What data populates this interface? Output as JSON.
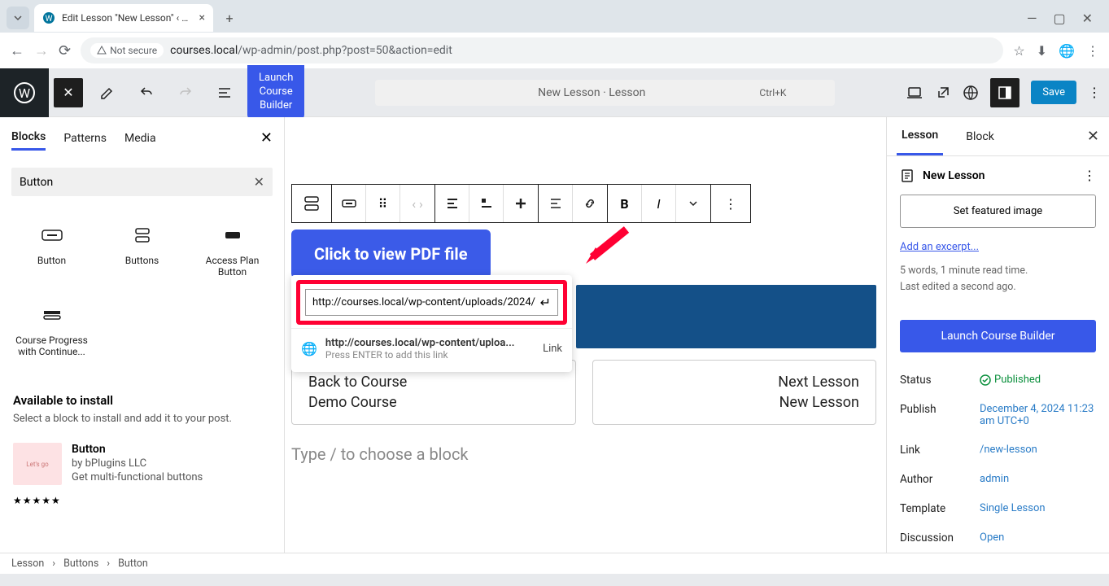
{
  "browser": {
    "tab_title": "Edit Lesson \"New Lesson\" ‹ cou",
    "not_secure": "Not secure",
    "url_host": "courses.local",
    "url_path": "/wp-admin/post.php?post=50&action=edit"
  },
  "toolbar": {
    "launch_btn": "Launch\nCourse\nBuilder",
    "doc_title": "New Lesson · Lesson",
    "shortcut": "Ctrl+K",
    "save": "Save"
  },
  "left": {
    "tabs": [
      "Blocks",
      "Patterns",
      "Media"
    ],
    "search_value": "Button",
    "blocks": [
      {
        "label": "Button"
      },
      {
        "label": "Buttons"
      },
      {
        "label": "Access Plan Button"
      },
      {
        "label": "Course Progress with Continue..."
      }
    ],
    "available_title": "Available to install",
    "available_sub": "Select a block to install and add it to your post.",
    "plugin": {
      "name": "Button",
      "by": "by bPlugins LLC",
      "desc": "Get multi-functional buttons",
      "thumb_text": "Let's go"
    }
  },
  "canvas": {
    "pdf_label": "Click to view PDF file",
    "link_input": "http://courses.local/wp-content/uploads/2024/",
    "link_result_url": "http://courses.local/wp-content/uploa...",
    "link_result_hint": "Press ENTER to add this link",
    "link_action": "Link",
    "back_title": "Back to Course",
    "back_sub": "Demo Course",
    "next_title": "Next Lesson",
    "next_sub": "New Lesson",
    "placeholder": "Type / to choose a block"
  },
  "right": {
    "tabs": [
      "Lesson",
      "Block"
    ],
    "heading": "New Lesson",
    "featured": "Set featured image",
    "excerpt": "Add an excerpt...",
    "meta1": "5 words, 1 minute read time.",
    "meta2": "Last edited a second ago.",
    "launch": "Launch Course Builder",
    "rows": [
      {
        "label": "Status",
        "value": "Published",
        "green": true
      },
      {
        "label": "Publish",
        "value": "December 4, 2024 11:23 am UTC+0"
      },
      {
        "label": "Link",
        "value": "/new-lesson"
      },
      {
        "label": "Author",
        "value": "admin"
      },
      {
        "label": "Template",
        "value": "Single Lesson"
      },
      {
        "label": "Discussion",
        "value": "Open"
      }
    ]
  },
  "footer": [
    "Lesson",
    "Buttons",
    "Button"
  ]
}
